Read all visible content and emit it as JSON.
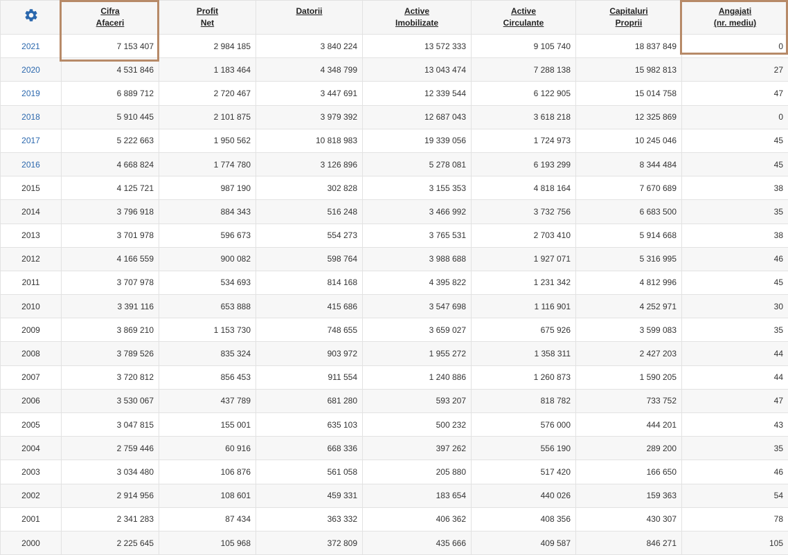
{
  "table": {
    "settings_icon": "gear-icon",
    "headers": [
      [
        "Cifra",
        "Afaceri"
      ],
      [
        "Profit",
        "Net"
      ],
      [
        "Datorii",
        ""
      ],
      [
        "Active",
        "Imobilizate"
      ],
      [
        "Active",
        "Circulante"
      ],
      [
        "Capitaluri",
        "Proprii"
      ],
      [
        "Angajați",
        "(nr. mediu)"
      ]
    ],
    "rows": [
      {
        "year": "2021",
        "link": true,
        "values": [
          "7 153 407",
          "2 984 185",
          "3 840 224",
          "13 572 333",
          "9 105 740",
          "18 837 849",
          "0"
        ]
      },
      {
        "year": "2020",
        "link": true,
        "values": [
          "4 531 846",
          "1 183 464",
          "4 348 799",
          "13 043 474",
          "7 288 138",
          "15 982 813",
          "27"
        ]
      },
      {
        "year": "2019",
        "link": true,
        "values": [
          "6 889 712",
          "2 720 467",
          "3 447 691",
          "12 339 544",
          "6 122 905",
          "15 014 758",
          "47"
        ]
      },
      {
        "year": "2018",
        "link": true,
        "values": [
          "5 910 445",
          "2 101 875",
          "3 979 392",
          "12 687 043",
          "3 618 218",
          "12 325 869",
          "0"
        ]
      },
      {
        "year": "2017",
        "link": true,
        "values": [
          "5 222 663",
          "1 950 562",
          "10 818 983",
          "19 339 056",
          "1 724 973",
          "10 245 046",
          "45"
        ]
      },
      {
        "year": "2016",
        "link": true,
        "values": [
          "4 668 824",
          "1 774 780",
          "3 126 896",
          "5 278 081",
          "6 193 299",
          "8 344 484",
          "45"
        ]
      },
      {
        "year": "2015",
        "link": false,
        "values": [
          "4 125 721",
          "987 190",
          "302 828",
          "3 155 353",
          "4 818 164",
          "7 670 689",
          "38"
        ]
      },
      {
        "year": "2014",
        "link": false,
        "values": [
          "3 796 918",
          "884 343",
          "516 248",
          "3 466 992",
          "3 732 756",
          "6 683 500",
          "35"
        ]
      },
      {
        "year": "2013",
        "link": false,
        "values": [
          "3 701 978",
          "596 673",
          "554 273",
          "3 765 531",
          "2 703 410",
          "5 914 668",
          "38"
        ]
      },
      {
        "year": "2012",
        "link": false,
        "values": [
          "4 166 559",
          "900 082",
          "598 764",
          "3 988 688",
          "1 927 071",
          "5 316 995",
          "46"
        ]
      },
      {
        "year": "2011",
        "link": false,
        "values": [
          "3 707 978",
          "534 693",
          "814 168",
          "4 395 822",
          "1 231 342",
          "4 812 996",
          "45"
        ]
      },
      {
        "year": "2010",
        "link": false,
        "values": [
          "3 391 116",
          "653 888",
          "415 686",
          "3 547 698",
          "1 116 901",
          "4 252 971",
          "30"
        ]
      },
      {
        "year": "2009",
        "link": false,
        "values": [
          "3 869 210",
          "1 153 730",
          "748 655",
          "3 659 027",
          "675 926",
          "3 599 083",
          "35"
        ]
      },
      {
        "year": "2008",
        "link": false,
        "values": [
          "3 789 526",
          "835 324",
          "903 972",
          "1 955 272",
          "1 358 311",
          "2 427 203",
          "44"
        ]
      },
      {
        "year": "2007",
        "link": false,
        "values": [
          "3 720 812",
          "856 453",
          "911 554",
          "1 240 886",
          "1 260 873",
          "1 590 205",
          "44"
        ]
      },
      {
        "year": "2006",
        "link": false,
        "values": [
          "3 530 067",
          "437 789",
          "681 280",
          "593 207",
          "818 782",
          "733 752",
          "47"
        ]
      },
      {
        "year": "2005",
        "link": false,
        "values": [
          "3 047 815",
          "155 001",
          "635 103",
          "500 232",
          "576 000",
          "444 201",
          "43"
        ]
      },
      {
        "year": "2004",
        "link": false,
        "values": [
          "2 759 446",
          "60 916",
          "668 336",
          "397 262",
          "556 190",
          "289 200",
          "35"
        ]
      },
      {
        "year": "2003",
        "link": false,
        "values": [
          "3 034 480",
          "106 876",
          "561 058",
          "205 880",
          "517 420",
          "166 650",
          "46"
        ]
      },
      {
        "year": "2002",
        "link": false,
        "values": [
          "2 914 956",
          "108 601",
          "459 331",
          "183 654",
          "440 026",
          "159 363",
          "54"
        ]
      },
      {
        "year": "2001",
        "link": false,
        "values": [
          "2 341 283",
          "87 434",
          "363 332",
          "406 362",
          "408 356",
          "430 307",
          "78"
        ]
      },
      {
        "year": "2000",
        "link": false,
        "values": [
          "2 225 645",
          "105 968",
          "372 809",
          "435 666",
          "409 587",
          "846 271",
          "105"
        ]
      }
    ]
  },
  "colors": {
    "link": "#2a67ad",
    "gear": "#2a67ad",
    "highlight_border": "#b78a68",
    "header_bg": "#f6f6f6",
    "stripe_bg": "#f7f7f7"
  }
}
